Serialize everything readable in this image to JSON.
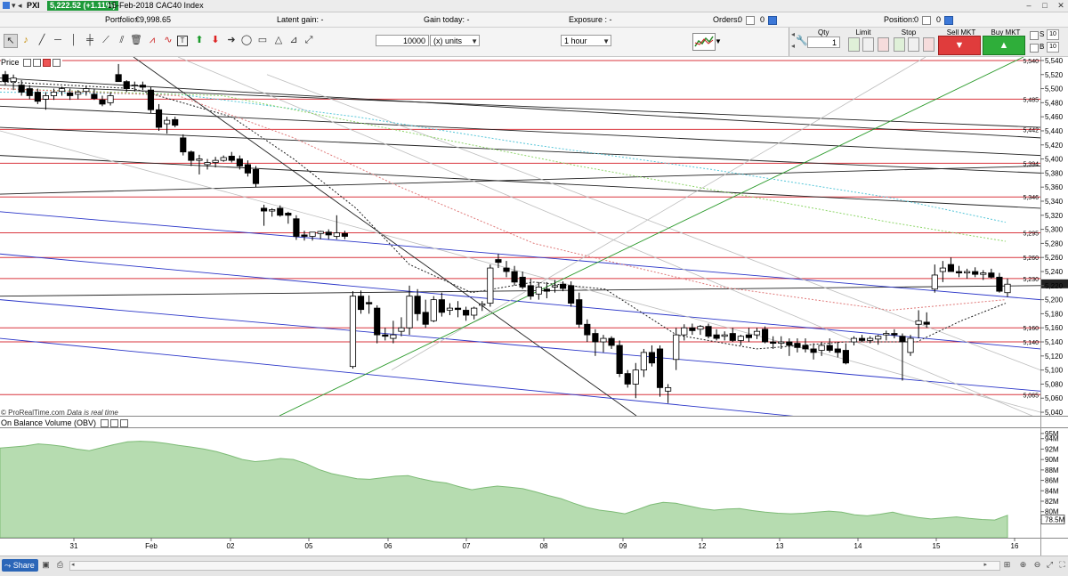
{
  "titlebar": {
    "symbol": "PXI",
    "price_change": "5,222.52 (+1.11%)",
    "title": "15-Feb-2018 CAC40 Index"
  },
  "status": {
    "portfolio_label": "Portfolio:",
    "portfolio_value": "€9,998.65",
    "latent_gain": "Latent gain: -",
    "gain_today": "Gain today: -",
    "exposure": "Exposure : -",
    "orders_label": "Orders:",
    "orders_a": "0",
    "orders_b": "0",
    "position_label": "Position:",
    "position_a": "0",
    "position_b": "0"
  },
  "toolbar": {
    "quantity": "10000",
    "units": "(x) units",
    "timeframe": "1 hour"
  },
  "order": {
    "qty_label": "Qty",
    "qty_value": "1",
    "limit_label": "Limit",
    "stop_label": "Stop",
    "sell_label": "Sell MKT",
    "buy_label": "Buy MKT",
    "s_label": "S",
    "b_label": "B",
    "s_value": "10",
    "b_value": "10"
  },
  "price_panel": {
    "label": "Price",
    "source": "© ProRealTime.com",
    "note": "Data is real time"
  },
  "obv_panel": {
    "label": "On Balance Volume (OBV)",
    "current": "78.5M"
  },
  "footer": {
    "share": "Share"
  },
  "chart_data": [
    {
      "type": "candlestick",
      "title": "CAC40 Index",
      "timeframe": "1 hour",
      "ylim": [
        5035,
        5545
      ],
      "y_ticks": [
        5040,
        5060,
        5080,
        5100,
        5120,
        5140,
        5160,
        5180,
        5200,
        5220,
        5240,
        5260,
        5280,
        5300,
        5320,
        5340,
        5360,
        5380,
        5400,
        5420,
        5440,
        5460,
        5480,
        5500,
        5520,
        5540
      ],
      "x_labels": [
        "31",
        "Feb",
        "02",
        "05",
        "06",
        "07",
        "08",
        "09",
        "12",
        "13",
        "14",
        "15",
        "16"
      ],
      "horizontal_levels": [
        5540,
        5485,
        5442,
        5394,
        5346,
        5295,
        5260,
        5230,
        5160,
        5140,
        5065
      ],
      "last_price": 5222.52,
      "candles": [
        [
          5520,
          5525,
          5505,
          5510
        ],
        [
          5510,
          5520,
          5498,
          5515
        ],
        [
          5505,
          5512,
          5490,
          5495
        ],
        [
          5500,
          5505,
          5485,
          5490
        ],
        [
          5495,
          5500,
          5478,
          5482
        ],
        [
          5485,
          5495,
          5470,
          5490
        ],
        [
          5490,
          5500,
          5484,
          5495
        ],
        [
          5496,
          5503,
          5490,
          5500
        ],
        [
          5494,
          5500,
          5484,
          5490
        ],
        [
          5492,
          5498,
          5485,
          5495
        ],
        [
          5496,
          5504,
          5490,
          5500
        ],
        [
          5492,
          5500,
          5484,
          5486
        ],
        [
          5484,
          5490,
          5475,
          5478
        ],
        [
          5480,
          5495,
          5476,
          5490
        ],
        [
          5520,
          5535,
          5515,
          5510
        ],
        [
          5510,
          5512,
          5495,
          5500
        ],
        [
          5505,
          5510,
          5496,
          5505
        ],
        [
          5505,
          5510,
          5498,
          5502
        ],
        [
          5498,
          5502,
          5465,
          5470
        ],
        [
          5470,
          5478,
          5440,
          5445
        ],
        [
          5450,
          5460,
          5436,
          5455
        ],
        [
          5456,
          5460,
          5445,
          5448
        ],
        [
          5430,
          5435,
          5405,
          5410
        ],
        [
          5410,
          5412,
          5390,
          5398
        ],
        [
          5398,
          5406,
          5378,
          5400
        ],
        [
          5392,
          5400,
          5385,
          5395
        ],
        [
          5395,
          5403,
          5388,
          5398
        ],
        [
          5398,
          5405,
          5396,
          5402
        ],
        [
          5404,
          5410,
          5395,
          5398
        ],
        [
          5400,
          5405,
          5385,
          5390
        ],
        [
          5392,
          5398,
          5375,
          5380
        ],
        [
          5385,
          5390,
          5360,
          5365
        ],
        [
          5330,
          5335,
          5305,
          5326
        ],
        [
          5326,
          5330,
          5318,
          5328
        ],
        [
          5330,
          5334,
          5318,
          5320
        ],
        [
          5323,
          5325,
          5308,
          5320
        ],
        [
          5315,
          5320,
          5285,
          5290
        ],
        [
          5292,
          5298,
          5284,
          5290
        ],
        [
          5290,
          5295,
          5284,
          5296
        ],
        [
          5294,
          5298,
          5286,
          5297
        ],
        [
          5296,
          5300,
          5286,
          5292
        ],
        [
          5290,
          5320,
          5286,
          5295
        ],
        [
          5294,
          5298,
          5286,
          5290
        ],
        [
          5105,
          5212,
          5102,
          5205
        ],
        [
          5205,
          5213,
          5180,
          5186
        ],
        [
          5196,
          5206,
          5180,
          5194
        ],
        [
          5188,
          5192,
          5138,
          5150
        ],
        [
          5150,
          5160,
          5142,
          5148
        ],
        [
          5145,
          5170,
          5138,
          5150
        ],
        [
          5155,
          5175,
          5148,
          5160
        ],
        [
          5160,
          5220,
          5150,
          5205
        ],
        [
          5205,
          5215,
          5170,
          5180
        ],
        [
          5182,
          5200,
          5160,
          5165
        ],
        [
          5170,
          5205,
          5168,
          5200
        ],
        [
          5200,
          5210,
          5176,
          5182
        ],
        [
          5185,
          5195,
          5178,
          5188
        ],
        [
          5188,
          5198,
          5175,
          5186
        ],
        [
          5185,
          5190,
          5170,
          5178
        ],
        [
          5178,
          5190,
          5172,
          5188
        ],
        [
          5192,
          5198,
          5184,
          5194
        ],
        [
          5195,
          5250,
          5190,
          5245
        ],
        [
          5257,
          5265,
          5245,
          5253
        ],
        [
          5245,
          5255,
          5232,
          5240
        ],
        [
          5240,
          5248,
          5220,
          5225
        ],
        [
          5232,
          5240,
          5215,
          5218
        ],
        [
          5220,
          5230,
          5200,
          5205
        ],
        [
          5208,
          5225,
          5200,
          5218
        ],
        [
          5215,
          5225,
          5202,
          5212
        ],
        [
          5218,
          5228,
          5210,
          5220
        ],
        [
          5222,
          5226,
          5212,
          5216
        ],
        [
          5220,
          5226,
          5190,
          5195
        ],
        [
          5200,
          5210,
          5160,
          5165
        ],
        [
          5165,
          5172,
          5140,
          5150
        ],
        [
          5152,
          5158,
          5120,
          5140
        ],
        [
          5140,
          5150,
          5125,
          5145
        ],
        [
          5145,
          5148,
          5130,
          5135
        ],
        [
          5135,
          5142,
          5090,
          5095
        ],
        [
          5095,
          5100,
          5075,
          5080
        ],
        [
          5080,
          5110,
          5060,
          5100
        ],
        [
          5100,
          5130,
          5090,
          5125
        ],
        [
          5125,
          5135,
          5105,
          5110
        ],
        [
          5130,
          5135,
          5062,
          5075
        ],
        [
          5070,
          5080,
          5053,
          5075
        ],
        [
          5115,
          5160,
          5100,
          5150
        ],
        [
          5150,
          5165,
          5142,
          5160
        ],
        [
          5160,
          5166,
          5150,
          5156
        ],
        [
          5158,
          5164,
          5150,
          5162
        ],
        [
          5162,
          5166,
          5145,
          5148
        ],
        [
          5150,
          5158,
          5142,
          5145
        ],
        [
          5148,
          5155,
          5142,
          5150
        ],
        [
          5152,
          5160,
          5140,
          5142
        ],
        [
          5142,
          5150,
          5135,
          5148
        ],
        [
          5150,
          5160,
          5140,
          5146
        ],
        [
          5150,
          5160,
          5144,
          5155
        ],
        [
          5158,
          5162,
          5138,
          5140
        ],
        [
          5140,
          5148,
          5130,
          5138
        ],
        [
          5138,
          5148,
          5130,
          5140
        ],
        [
          5140,
          5145,
          5120,
          5135
        ],
        [
          5138,
          5145,
          5125,
          5132
        ],
        [
          5135,
          5145,
          5125,
          5130
        ],
        [
          5130,
          5138,
          5115,
          5125
        ],
        [
          5128,
          5140,
          5120,
          5135
        ],
        [
          5135,
          5145,
          5125,
          5128
        ],
        [
          5130,
          5140,
          5118,
          5125
        ],
        [
          5128,
          5138,
          5108,
          5110
        ],
        [
          5140,
          5148,
          5135,
          5145
        ],
        [
          5145,
          5150,
          5140,
          5142
        ],
        [
          5142,
          5148,
          5138,
          5145
        ],
        [
          5144,
          5150,
          5136,
          5148
        ],
        [
          5150,
          5156,
          5142,
          5152
        ],
        [
          5152,
          5158,
          5145,
          5150
        ],
        [
          5148,
          5152,
          5085,
          5140
        ],
        [
          5125,
          5150,
          5120,
          5145
        ],
        [
          5165,
          5185,
          5145,
          5170
        ],
        [
          5168,
          5182,
          5160,
          5165
        ],
        [
          5215,
          5250,
          5210,
          5235
        ],
        [
          5240,
          5255,
          5225,
          5245
        ],
        [
          5250,
          5260,
          5240,
          5240
        ],
        [
          5240,
          5248,
          5232,
          5238
        ],
        [
          5238,
          5244,
          5230,
          5240
        ],
        [
          5240,
          5246,
          5232,
          5236
        ],
        [
          5236,
          5242,
          5228,
          5238
        ],
        [
          5238,
          5244,
          5230,
          5232
        ],
        [
          5232,
          5238,
          5210,
          5212
        ],
        [
          5210,
          5230,
          5204,
          5222
        ]
      ]
    },
    {
      "type": "area",
      "title": "On Balance Volume (OBV)",
      "ylim": [
        75,
        96
      ],
      "y_ticks_labels": [
        "95M",
        "94M",
        "92M",
        "90M",
        "88M",
        "86M",
        "84M",
        "82M",
        "80M",
        "78.5M"
      ],
      "y_ticks": [
        95,
        94,
        92,
        90,
        88,
        86,
        84,
        82,
        80,
        78.5
      ],
      "x_labels": [
        "31",
        "Feb",
        "02",
        "05",
        "06",
        "07",
        "08",
        "09",
        "12",
        "13",
        "14",
        "15",
        "16"
      ],
      "values": [
        92.2,
        92.4,
        92.6,
        93.0,
        92.8,
        92.5,
        92.0,
        91.7,
        92.3,
        92.9,
        93.4,
        93.5,
        93.4,
        93.1,
        92.7,
        92.4,
        92.0,
        91.5,
        90.8,
        90.0,
        89.6,
        89.8,
        90.2,
        90.0,
        89.2,
        88.1,
        87.3,
        86.8,
        86.3,
        86.2,
        86.5,
        86.8,
        86.9,
        86.3,
        85.8,
        85.5,
        84.8,
        84.2,
        84.6,
        84.9,
        84.7,
        84.4,
        83.8,
        83.1,
        82.5,
        81.6,
        80.8,
        80.3,
        80.0,
        79.6,
        80.4,
        81.3,
        81.8,
        81.6,
        81.1,
        80.6,
        80.3,
        80.5,
        80.6,
        80.2,
        79.9,
        79.7,
        79.6,
        79.7,
        79.9,
        80.1,
        79.9,
        79.4,
        79.2,
        79.5,
        79.9,
        79.3,
        78.9,
        78.6,
        78.8,
        79.0,
        78.7,
        78.5,
        78.4,
        79.3
      ]
    }
  ]
}
